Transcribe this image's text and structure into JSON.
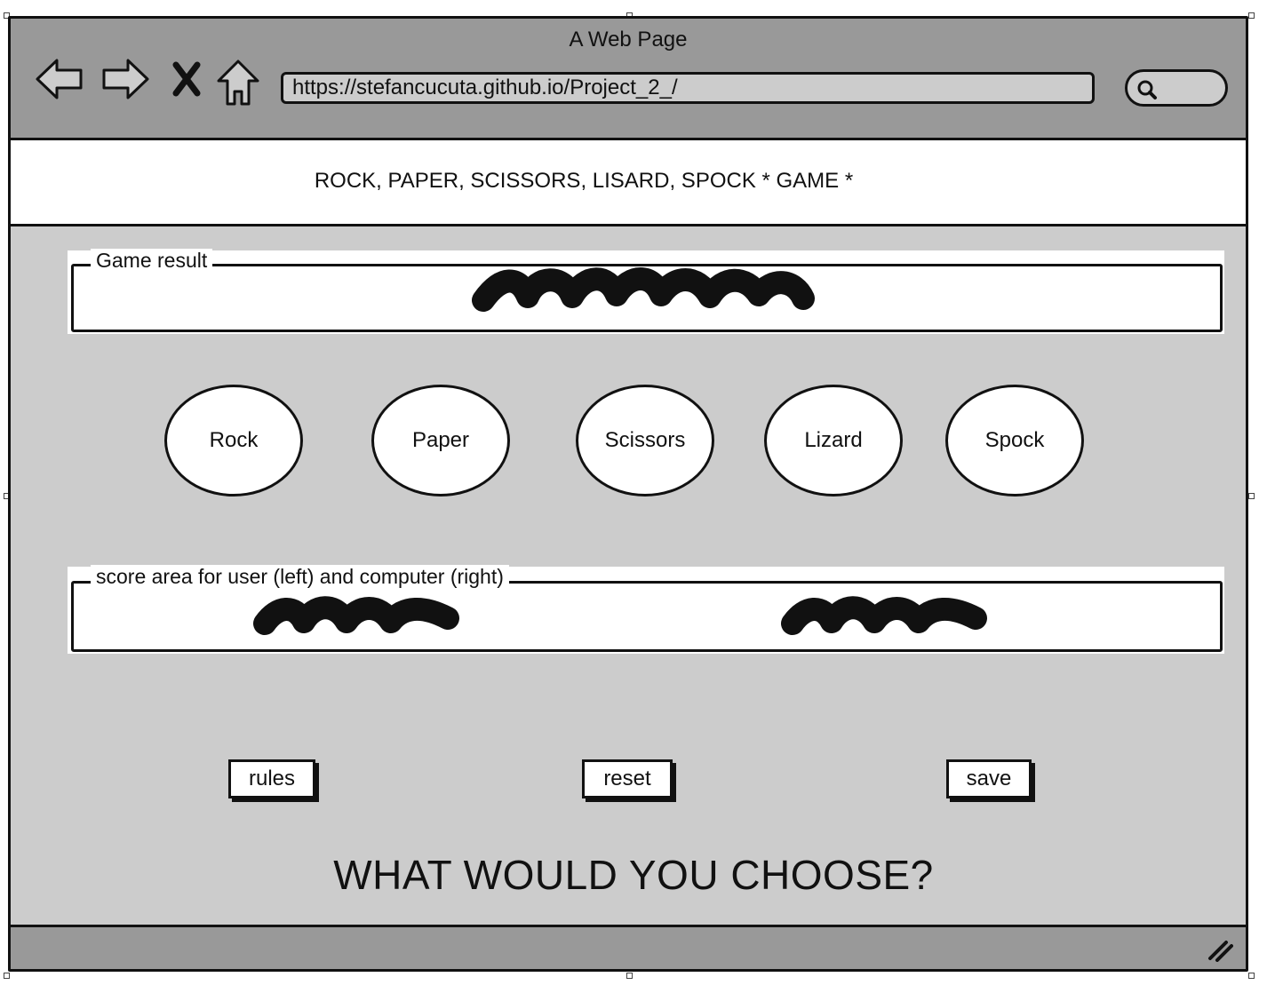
{
  "window": {
    "title": "A Web Page",
    "url": "https://stefancucuta.github.io/Project_2_/"
  },
  "toolbar": {
    "icons": [
      "back-arrow-icon",
      "forward-arrow-icon",
      "close-x-icon",
      "home-icon",
      "search-icon"
    ]
  },
  "header": {
    "title": "ROCK, PAPER, SCISSORS, LISARD, SPOCK * GAME *"
  },
  "game_result": {
    "legend": "Game result"
  },
  "choices": [
    {
      "label": "Rock"
    },
    {
      "label": "Paper"
    },
    {
      "label": "Scissors"
    },
    {
      "label": "Lizard"
    },
    {
      "label": "Spock"
    }
  ],
  "score": {
    "legend": "score area for user (left) and computer (right)"
  },
  "buttons": {
    "rules": "rules",
    "reset": "reset",
    "save": "save"
  },
  "prompt": {
    "question": "WHAT WOULD YOU CHOOSE?"
  },
  "colors": {
    "chrome": "#999999",
    "page": "#cccccc",
    "panel": "#ffffff",
    "ink": "#111111"
  }
}
